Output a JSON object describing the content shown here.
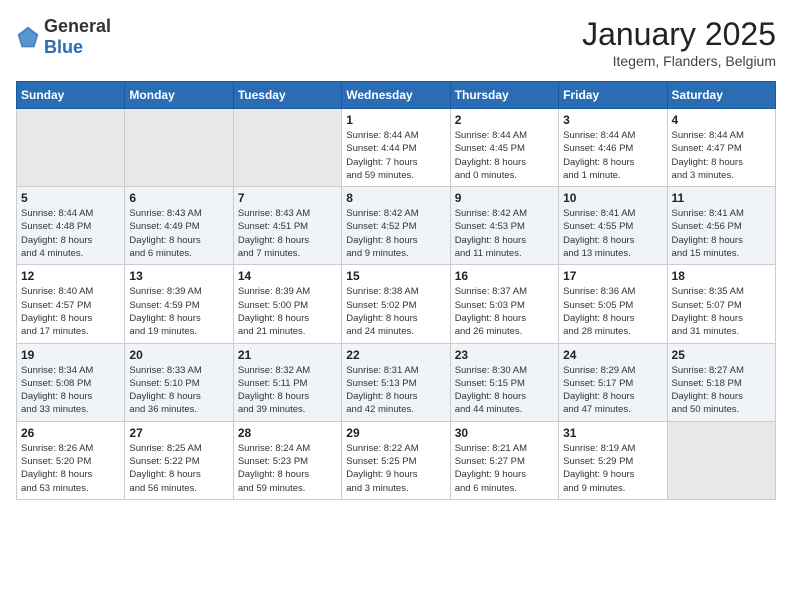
{
  "header": {
    "logo_general": "General",
    "logo_blue": "Blue",
    "month_title": "January 2025",
    "location": "Itegem, Flanders, Belgium"
  },
  "days_of_week": [
    "Sunday",
    "Monday",
    "Tuesday",
    "Wednesday",
    "Thursday",
    "Friday",
    "Saturday"
  ],
  "weeks": [
    [
      {
        "day": "",
        "info": ""
      },
      {
        "day": "",
        "info": ""
      },
      {
        "day": "",
        "info": ""
      },
      {
        "day": "1",
        "info": "Sunrise: 8:44 AM\nSunset: 4:44 PM\nDaylight: 7 hours\nand 59 minutes."
      },
      {
        "day": "2",
        "info": "Sunrise: 8:44 AM\nSunset: 4:45 PM\nDaylight: 8 hours\nand 0 minutes."
      },
      {
        "day": "3",
        "info": "Sunrise: 8:44 AM\nSunset: 4:46 PM\nDaylight: 8 hours\nand 1 minute."
      },
      {
        "day": "4",
        "info": "Sunrise: 8:44 AM\nSunset: 4:47 PM\nDaylight: 8 hours\nand 3 minutes."
      }
    ],
    [
      {
        "day": "5",
        "info": "Sunrise: 8:44 AM\nSunset: 4:48 PM\nDaylight: 8 hours\nand 4 minutes."
      },
      {
        "day": "6",
        "info": "Sunrise: 8:43 AM\nSunset: 4:49 PM\nDaylight: 8 hours\nand 6 minutes."
      },
      {
        "day": "7",
        "info": "Sunrise: 8:43 AM\nSunset: 4:51 PM\nDaylight: 8 hours\nand 7 minutes."
      },
      {
        "day": "8",
        "info": "Sunrise: 8:42 AM\nSunset: 4:52 PM\nDaylight: 8 hours\nand 9 minutes."
      },
      {
        "day": "9",
        "info": "Sunrise: 8:42 AM\nSunset: 4:53 PM\nDaylight: 8 hours\nand 11 minutes."
      },
      {
        "day": "10",
        "info": "Sunrise: 8:41 AM\nSunset: 4:55 PM\nDaylight: 8 hours\nand 13 minutes."
      },
      {
        "day": "11",
        "info": "Sunrise: 8:41 AM\nSunset: 4:56 PM\nDaylight: 8 hours\nand 15 minutes."
      }
    ],
    [
      {
        "day": "12",
        "info": "Sunrise: 8:40 AM\nSunset: 4:57 PM\nDaylight: 8 hours\nand 17 minutes."
      },
      {
        "day": "13",
        "info": "Sunrise: 8:39 AM\nSunset: 4:59 PM\nDaylight: 8 hours\nand 19 minutes."
      },
      {
        "day": "14",
        "info": "Sunrise: 8:39 AM\nSunset: 5:00 PM\nDaylight: 8 hours\nand 21 minutes."
      },
      {
        "day": "15",
        "info": "Sunrise: 8:38 AM\nSunset: 5:02 PM\nDaylight: 8 hours\nand 24 minutes."
      },
      {
        "day": "16",
        "info": "Sunrise: 8:37 AM\nSunset: 5:03 PM\nDaylight: 8 hours\nand 26 minutes."
      },
      {
        "day": "17",
        "info": "Sunrise: 8:36 AM\nSunset: 5:05 PM\nDaylight: 8 hours\nand 28 minutes."
      },
      {
        "day": "18",
        "info": "Sunrise: 8:35 AM\nSunset: 5:07 PM\nDaylight: 8 hours\nand 31 minutes."
      }
    ],
    [
      {
        "day": "19",
        "info": "Sunrise: 8:34 AM\nSunset: 5:08 PM\nDaylight: 8 hours\nand 33 minutes."
      },
      {
        "day": "20",
        "info": "Sunrise: 8:33 AM\nSunset: 5:10 PM\nDaylight: 8 hours\nand 36 minutes."
      },
      {
        "day": "21",
        "info": "Sunrise: 8:32 AM\nSunset: 5:11 PM\nDaylight: 8 hours\nand 39 minutes."
      },
      {
        "day": "22",
        "info": "Sunrise: 8:31 AM\nSunset: 5:13 PM\nDaylight: 8 hours\nand 42 minutes."
      },
      {
        "day": "23",
        "info": "Sunrise: 8:30 AM\nSunset: 5:15 PM\nDaylight: 8 hours\nand 44 minutes."
      },
      {
        "day": "24",
        "info": "Sunrise: 8:29 AM\nSunset: 5:17 PM\nDaylight: 8 hours\nand 47 minutes."
      },
      {
        "day": "25",
        "info": "Sunrise: 8:27 AM\nSunset: 5:18 PM\nDaylight: 8 hours\nand 50 minutes."
      }
    ],
    [
      {
        "day": "26",
        "info": "Sunrise: 8:26 AM\nSunset: 5:20 PM\nDaylight: 8 hours\nand 53 minutes."
      },
      {
        "day": "27",
        "info": "Sunrise: 8:25 AM\nSunset: 5:22 PM\nDaylight: 8 hours\nand 56 minutes."
      },
      {
        "day": "28",
        "info": "Sunrise: 8:24 AM\nSunset: 5:23 PM\nDaylight: 8 hours\nand 59 minutes."
      },
      {
        "day": "29",
        "info": "Sunrise: 8:22 AM\nSunset: 5:25 PM\nDaylight: 9 hours\nand 3 minutes."
      },
      {
        "day": "30",
        "info": "Sunrise: 8:21 AM\nSunset: 5:27 PM\nDaylight: 9 hours\nand 6 minutes."
      },
      {
        "day": "31",
        "info": "Sunrise: 8:19 AM\nSunset: 5:29 PM\nDaylight: 9 hours\nand 9 minutes."
      },
      {
        "day": "",
        "info": ""
      }
    ]
  ]
}
